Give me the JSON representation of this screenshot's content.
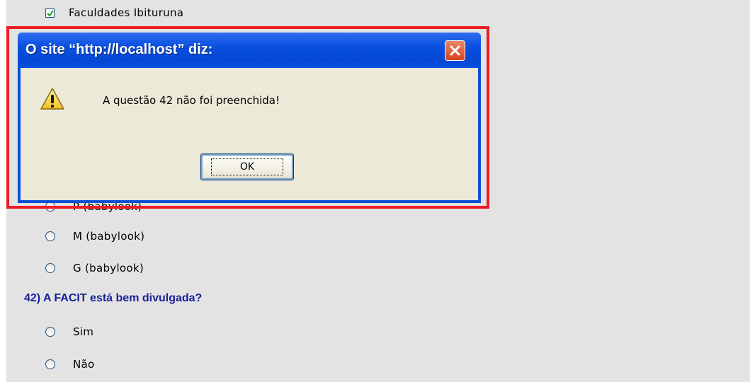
{
  "form": {
    "checkbox_option": {
      "label": "Faculdades Ibituruna",
      "checked": true
    },
    "shirt_size_options": [
      {
        "label": "P (babylook)"
      },
      {
        "label": "M (babylook)"
      },
      {
        "label": "G (babylook)"
      }
    ],
    "question_42": {
      "text": "42) A FACIT está bem divulgada?",
      "options": [
        {
          "label": "Sim"
        },
        {
          "label": "Não"
        }
      ]
    }
  },
  "dialog": {
    "title": "O site “http://localhost” diz:",
    "message": "A questão 42 não foi preenchida!",
    "ok_label": "OK",
    "icon": "warning-icon",
    "close_icon": "close-icon"
  },
  "colors": {
    "page_background": "#e3e3e3",
    "question_text": "#18209a",
    "highlight_border": "#ee1b24",
    "titlebar": "#0a50e0",
    "dialog_body": "#ece9d8"
  }
}
